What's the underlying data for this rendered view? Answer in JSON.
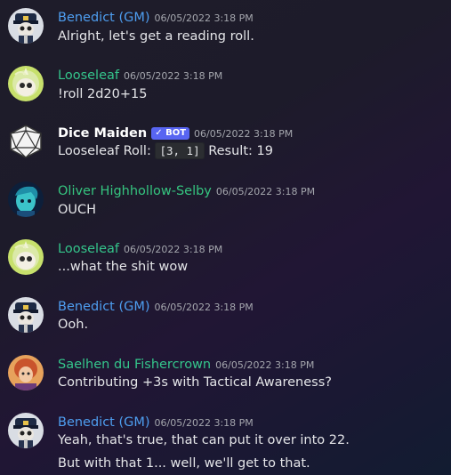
{
  "colors": {
    "gm": "#4e9ef0",
    "looseleaf": "#34c58b",
    "bot": "#ffffff",
    "oliver": "#35c47f",
    "saelhen": "#34c58b",
    "bot_tag": "#5865f2"
  },
  "messages": [
    {
      "author": "Benedict (GM)",
      "timestamp": "06/05/2022 3:18 PM",
      "text": "Alright, let's get a reading roll.",
      "avatar": "benedict-avatar"
    },
    {
      "author": "Looseleaf",
      "timestamp": "06/05/2022 3:18 PM",
      "text": "!roll 2d20+15",
      "avatar": "looseleaf-avatar"
    },
    {
      "author": "Dice Maiden",
      "bot_tag": "BOT",
      "timestamp": "06/05/2022 3:18 PM",
      "text_prefix": "Looseleaf Roll: ",
      "code": "[3, 1]",
      "text_suffix": " Result: 19",
      "avatar": "dice-avatar"
    },
    {
      "author": "Oliver Highhollow-Selby",
      "timestamp": "06/05/2022 3:18 PM",
      "text": "OUCH",
      "avatar": "oliver-avatar"
    },
    {
      "author": "Looseleaf",
      "timestamp": "06/05/2022 3:18 PM",
      "text": "...what the shit wow",
      "avatar": "looseleaf-avatar"
    },
    {
      "author": "Benedict (GM)",
      "timestamp": "06/05/2022 3:18 PM",
      "text": "Ooh.",
      "avatar": "benedict-avatar"
    },
    {
      "author": "Saelhen du Fishercrown",
      "timestamp": "06/05/2022 3:18 PM",
      "text": "Contributing +3s with Tactical Awareness?",
      "avatar": "saelhen-avatar"
    },
    {
      "author": "Benedict (GM)",
      "timestamp": "06/05/2022 3:18 PM",
      "text": "Yeah, that's true, that can put it over into 22.",
      "text2": "But with that 1... well, we'll get to that.",
      "avatar": "benedict-avatar"
    }
  ]
}
